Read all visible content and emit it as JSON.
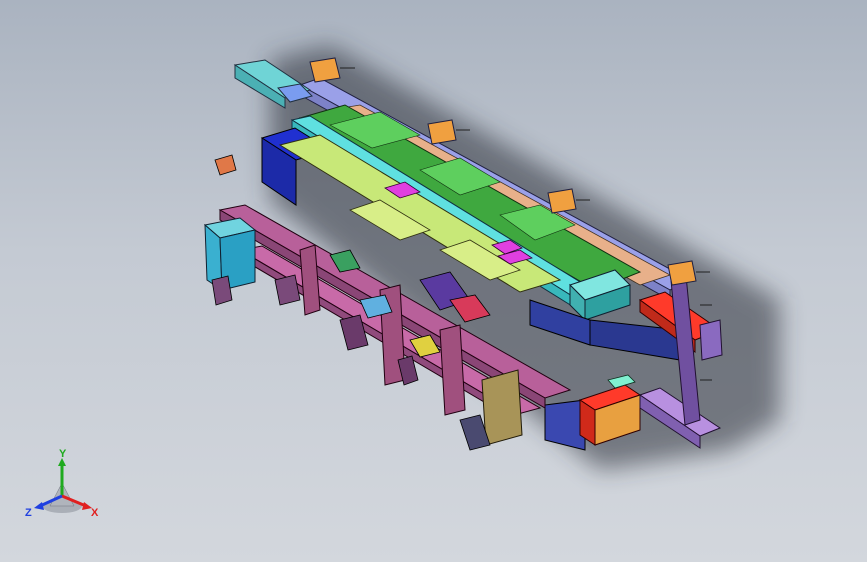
{
  "viewport": {
    "background_top": "#aab3c0",
    "background_bottom": "#d3d7dd"
  },
  "triad": {
    "y_label": "Y",
    "x_label": "X",
    "z_label": "Z",
    "y_color": "#1faa1f",
    "x_color": "#e02020",
    "z_color": "#2040e0"
  },
  "model": {
    "description_icon": "cad-assembly-icon"
  }
}
